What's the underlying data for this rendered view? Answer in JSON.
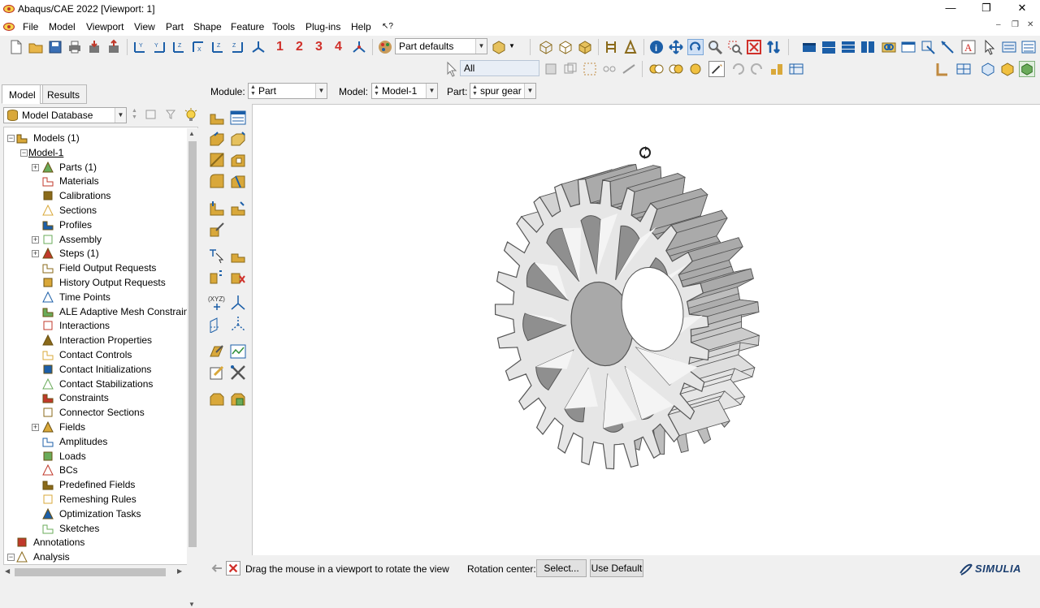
{
  "window": {
    "title": "Abaqus/CAE 2022 [Viewport: 1]",
    "minimize": "—",
    "restore": "❐",
    "close": "✕"
  },
  "menu": {
    "items": [
      "File",
      "Model",
      "Viewport",
      "View",
      "Part",
      "Shape",
      "Feature",
      "Tools",
      "Plug-ins",
      "Help"
    ],
    "help_cursor": "↖?",
    "mdi_minimize": "–",
    "mdi_restore": "❐",
    "mdi_close": "✕"
  },
  "toolbar": {
    "view_numbers": [
      "1",
      "2",
      "3",
      "4"
    ],
    "render_style": "Part defaults",
    "selection_filter": "All"
  },
  "context": {
    "module_label": "Module:",
    "module_value": "Part",
    "model_label": "Model:",
    "model_value": "Model-1",
    "part_label": "Part:",
    "part_value": "spur gear"
  },
  "left_panel": {
    "tabs": [
      "Model",
      "Results"
    ],
    "active_tab": "Model",
    "database_selector": "Model Database",
    "tree": [
      {
        "label": "Models (1)",
        "icon": "models-icon",
        "depth": 0,
        "expander": "−"
      },
      {
        "label": "Model-1",
        "icon": "",
        "depth": 1,
        "expander": "−"
      },
      {
        "label": "Parts (1)",
        "icon": "parts-icon",
        "depth": 2,
        "expander": "+"
      },
      {
        "label": "Materials",
        "icon": "materials-icon",
        "depth": 2,
        "expander": ""
      },
      {
        "label": "Calibrations",
        "icon": "calibrations-icon",
        "depth": 2,
        "expander": ""
      },
      {
        "label": "Sections",
        "icon": "sections-icon",
        "depth": 2,
        "expander": ""
      },
      {
        "label": "Profiles",
        "icon": "profiles-icon",
        "depth": 2,
        "expander": ""
      },
      {
        "label": "Assembly",
        "icon": "assembly-icon",
        "depth": 2,
        "expander": "+"
      },
      {
        "label": "Steps (1)",
        "icon": "steps-icon",
        "depth": 2,
        "expander": "+"
      },
      {
        "label": "Field Output Requests",
        "icon": "field-output-icon",
        "depth": 2,
        "expander": ""
      },
      {
        "label": "History Output Requests",
        "icon": "history-output-icon",
        "depth": 2,
        "expander": ""
      },
      {
        "label": "Time Points",
        "icon": "time-points-icon",
        "depth": 2,
        "expander": ""
      },
      {
        "label": "ALE Adaptive Mesh Constraints",
        "icon": "ale-mesh-icon",
        "depth": 2,
        "expander": ""
      },
      {
        "label": "Interactions",
        "icon": "interactions-icon",
        "depth": 2,
        "expander": ""
      },
      {
        "label": "Interaction Properties",
        "icon": "interaction-properties-icon",
        "depth": 2,
        "expander": ""
      },
      {
        "label": "Contact Controls",
        "icon": "contact-controls-icon",
        "depth": 2,
        "expander": ""
      },
      {
        "label": "Contact Initializations",
        "icon": "contact-initializations-icon",
        "depth": 2,
        "expander": ""
      },
      {
        "label": "Contact Stabilizations",
        "icon": "contact-stabilizations-icon",
        "depth": 2,
        "expander": ""
      },
      {
        "label": "Constraints",
        "icon": "constraints-icon",
        "depth": 2,
        "expander": ""
      },
      {
        "label": "Connector Sections",
        "icon": "connector-sections-icon",
        "depth": 2,
        "expander": ""
      },
      {
        "label": "Fields",
        "icon": "fields-icon",
        "depth": 2,
        "expander": "+"
      },
      {
        "label": "Amplitudes",
        "icon": "amplitudes-icon",
        "depth": 2,
        "expander": ""
      },
      {
        "label": "Loads",
        "icon": "loads-icon",
        "depth": 2,
        "expander": ""
      },
      {
        "label": "BCs",
        "icon": "bcs-icon",
        "depth": 2,
        "expander": ""
      },
      {
        "label": "Predefined Fields",
        "icon": "predefined-fields-icon",
        "depth": 2,
        "expander": ""
      },
      {
        "label": "Remeshing Rules",
        "icon": "remeshing-rules-icon",
        "depth": 2,
        "expander": ""
      },
      {
        "label": "Optimization Tasks",
        "icon": "optimization-tasks-icon",
        "depth": 2,
        "expander": ""
      },
      {
        "label": "Sketches",
        "icon": "sketches-icon",
        "depth": 2,
        "expander": ""
      },
      {
        "label": "Annotations",
        "icon": "annotations-icon",
        "depth": 0,
        "expander": ""
      },
      {
        "label": "Analysis",
        "icon": "analysis-icon",
        "depth": 0,
        "expander": "−"
      }
    ]
  },
  "status": {
    "prompt": "Drag the mouse in a viewport to rotate the view",
    "rotation_center_label": "Rotation center:",
    "select_button": "Select...",
    "use_default_button": "Use Default",
    "brand": "SIMULIA"
  },
  "colors": {
    "accent_blue": "#1c5fa8",
    "gear_face": "#e6e6e6",
    "gear_edge": "#555555",
    "icon_gold": "#d9a83a",
    "cancel_red": "#d0302a"
  }
}
